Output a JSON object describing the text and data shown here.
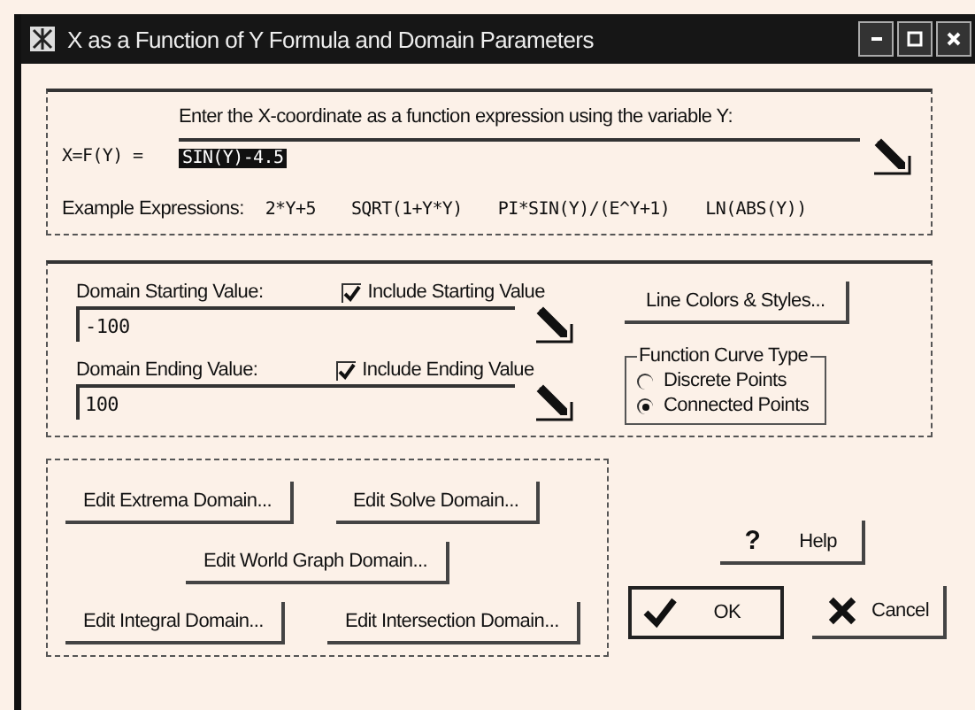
{
  "window": {
    "title": "X as a Function of Y Formula and Domain Parameters"
  },
  "formula": {
    "prompt": "Enter the X-coordinate as a function expression using the variable Y:",
    "label": "X=F(Y) =",
    "value": "SIN(Y)-4.5",
    "text_selected": true,
    "examples_label": "Example Expressions:",
    "examples": [
      "2*Y+5",
      "SQRT(1+Y*Y)",
      "PI*SIN(Y)/(E^Y+1)",
      "LN(ABS(Y))"
    ]
  },
  "domain": [
    {
      "label": "Domain Starting Value:",
      "include_label": "Include Starting Value",
      "checked": true,
      "value": "-100"
    },
    {
      "label": "Domain Ending Value:",
      "include_label": "Include Ending Value",
      "checked": true,
      "value": "100"
    }
  ],
  "line_styles_button": "Line Colors & Styles...",
  "curve_type": {
    "title": "Function Curve Type",
    "options": [
      {
        "label": "Discrete Points",
        "selected": false
      },
      {
        "label": "Connected Points",
        "selected": true
      }
    ]
  },
  "edit_buttons": [
    [
      "Edit Extrema Domain...",
      "Edit Solve Domain..."
    ],
    [
      "Edit World Graph Domain..."
    ],
    [
      "Edit Integral Domain...",
      "Edit Intersection Domain..."
    ]
  ],
  "help_button": {
    "icon": "?",
    "label": "Help"
  },
  "ok_button": "OK",
  "cancel_button": "Cancel"
}
